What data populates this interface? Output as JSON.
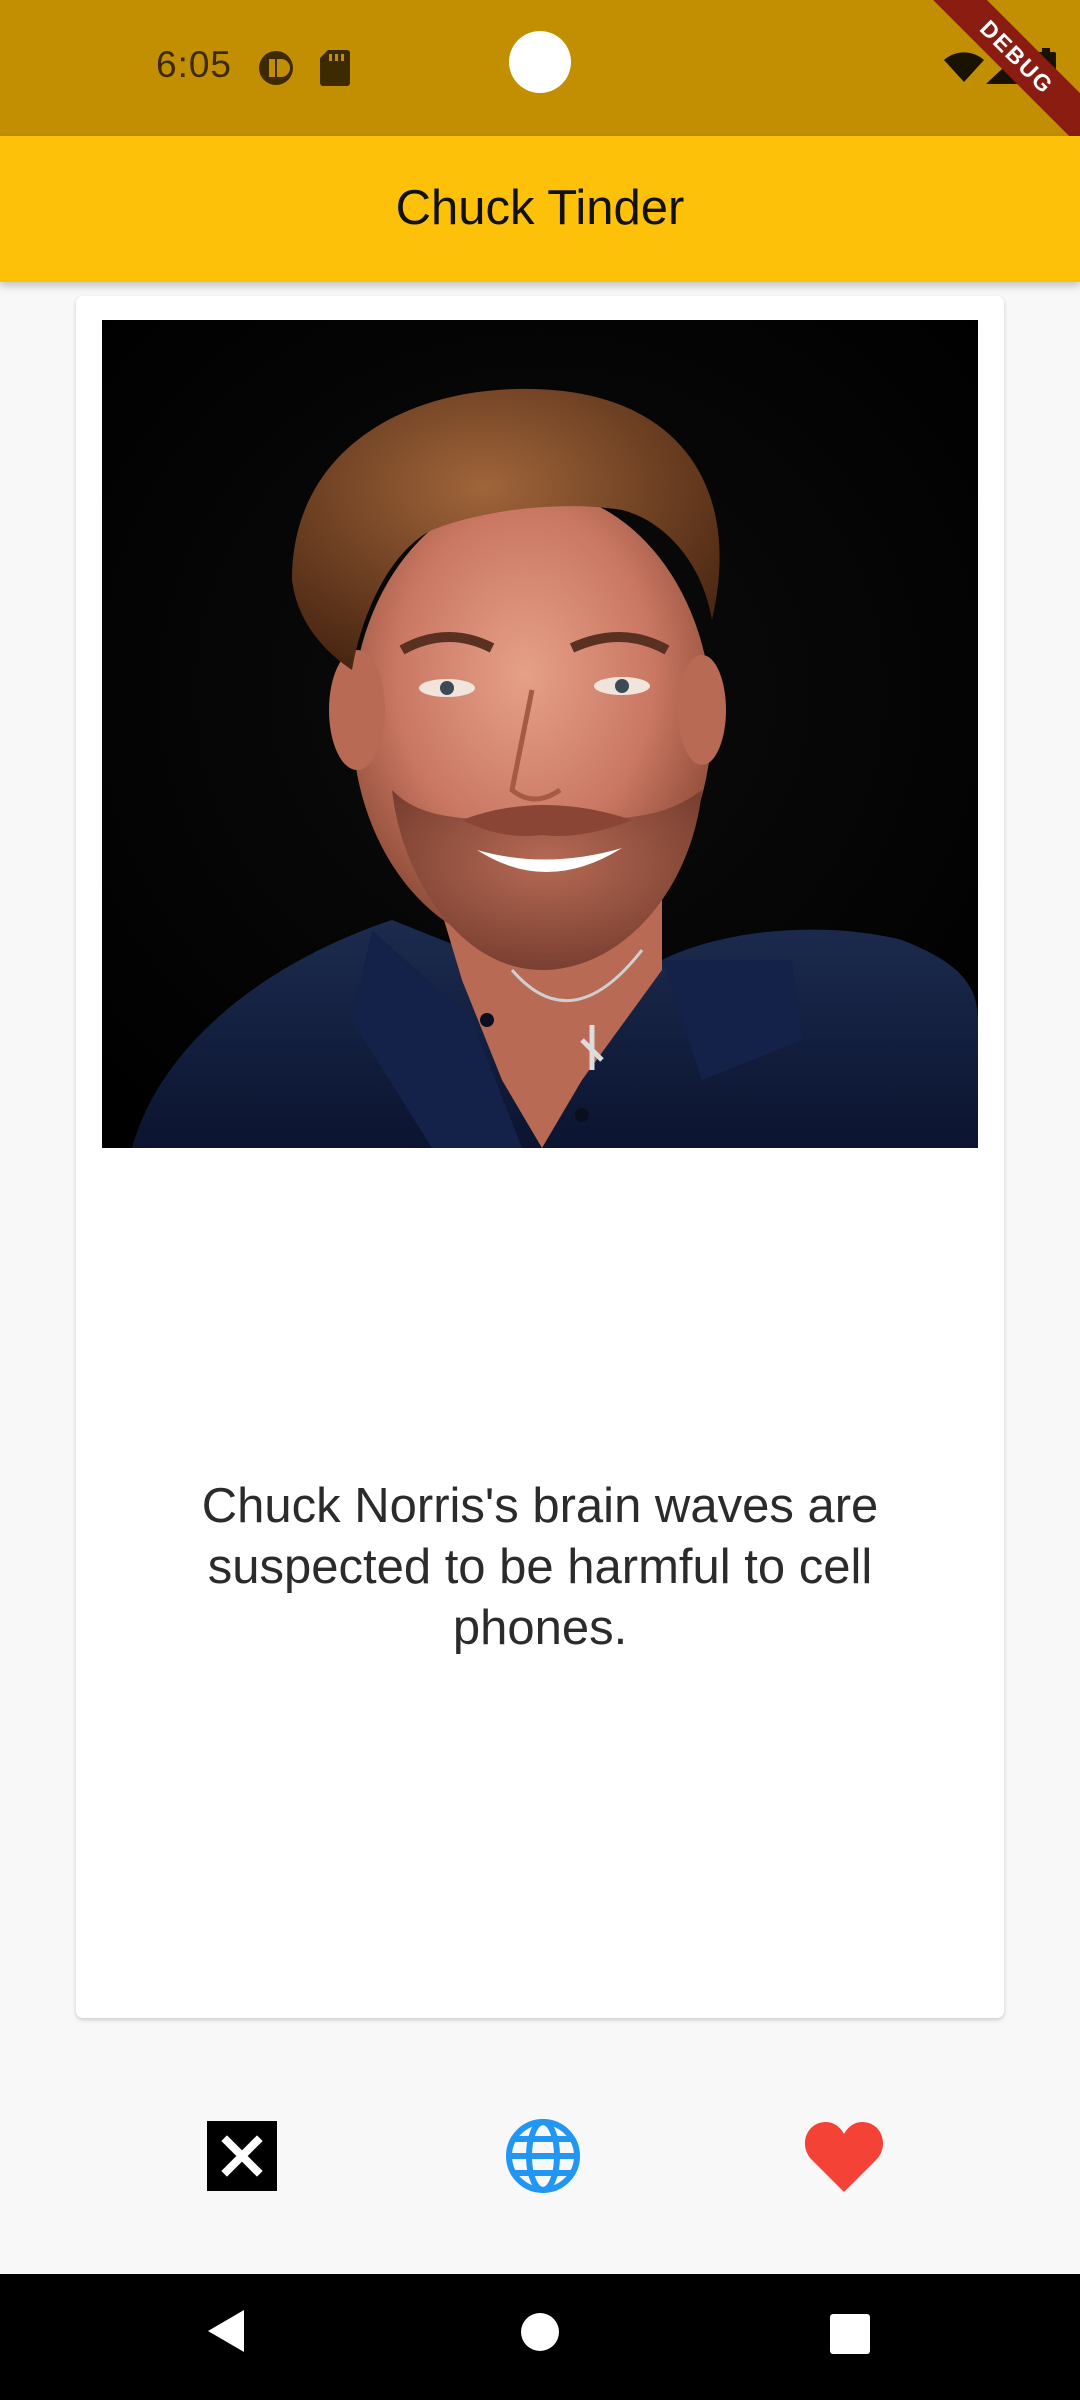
{
  "status_bar": {
    "time": "6:05",
    "debug_label": "DEBUG",
    "icons": [
      "pause-circle-icon",
      "sd-card-icon",
      "wifi-icon",
      "signal-icon",
      "battery-icon"
    ],
    "color": "#c28f03"
  },
  "app_bar": {
    "title": "Chuck Tinder",
    "color": "#fec109"
  },
  "card": {
    "image_alt": "Portrait of Chuck Norris",
    "joke": "Chuck Norris's brain waves are suspected to be harmful to cell phones."
  },
  "actions": {
    "dislike_icon": "close-box-icon",
    "open_web_icon": "globe-icon",
    "like_icon": "heart-icon",
    "web_color": "#2196f3",
    "like_color": "#f44336"
  },
  "nav_bar": {
    "icons": [
      "back-icon",
      "home-icon",
      "recents-icon"
    ]
  }
}
